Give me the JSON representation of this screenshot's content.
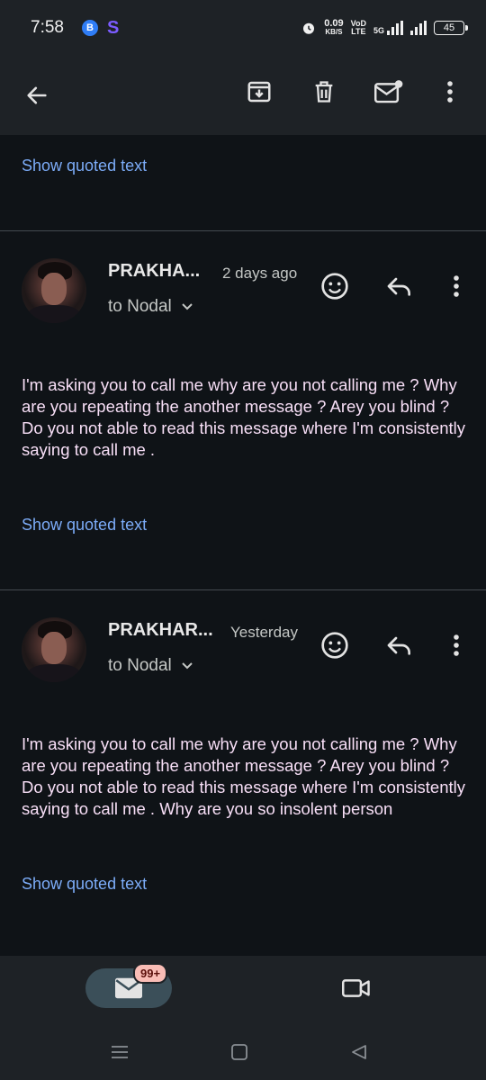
{
  "status_bar": {
    "time": "7:58",
    "badge_b": "B",
    "badge_s": "S",
    "net_speed_value": "0.09",
    "net_speed_unit": "KB/S",
    "volte_top": "VoD",
    "volte_bottom": "LTE",
    "network": "5G",
    "battery": "45"
  },
  "app_bar": {
    "icons": [
      "back-arrow-icon",
      "archive-icon",
      "delete-icon",
      "mark-unread-icon",
      "more-vert-icon"
    ]
  },
  "top_link": "Show quoted text",
  "messages": [
    {
      "sender": "PRAKHA...",
      "date": "2 days ago",
      "to": "to Nodal",
      "body": "I'm asking you to call me why are you not calling me ? Why are you repeating the another message ? Arey you blind ? Do you not able to read this message where I'm consistently saying to call me .",
      "show_quoted": "Show quoted text"
    },
    {
      "sender": "PRAKHAR...",
      "date": "Yesterday",
      "to": "to Nodal",
      "body": "I'm asking you to call me why are you not calling me ? Why are you repeating the another message ? Arey you blind ? Do you not able to read this message where I'm consistently saying to call me . Why are you so insolent person",
      "show_quoted": "Show quoted text"
    }
  ],
  "bottom_nav": {
    "mail_badge": "99+",
    "icons": [
      "mail-icon",
      "video-camera-icon"
    ]
  },
  "system_nav": {
    "icons": [
      "recents-icon",
      "home-icon",
      "back-triangle-icon"
    ]
  },
  "colors": {
    "background": "#0f1317",
    "bar": "#1e2226",
    "link": "#7cacf8",
    "body_text": "#f8dff7",
    "pill": "#3b4f59",
    "badge": "#f9bdb6"
  }
}
